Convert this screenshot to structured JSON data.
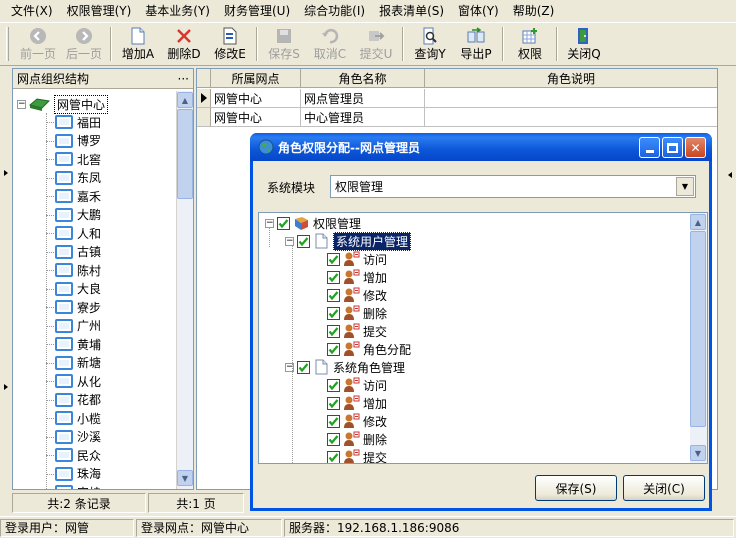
{
  "menu": [
    "文件(X)",
    "权限管理(Y)",
    "基本业务(Y)",
    "财务管理(U)",
    "综合功能(I)",
    "报表清单(S)",
    "窗体(Y)",
    "帮助(Z)"
  ],
  "toolbar": {
    "prev": "前一页",
    "next": "后一页",
    "add": "增加A",
    "delete": "删除D",
    "edit": "修改E",
    "save": "保存S",
    "cancel": "取消C",
    "submit": "提交U",
    "query": "查询Y",
    "export": "导出P",
    "permission": "权限",
    "close": "关闭Q"
  },
  "left_panel": {
    "title": "网点组织结构",
    "menu_dots": "···",
    "root": "网管中心",
    "nodes": [
      "福田",
      "博罗",
      "北窖",
      "东凤",
      "嘉禾",
      "大鹏",
      "人和",
      "古镇",
      "陈村",
      "大良",
      "寮步",
      "广州",
      "黄埔",
      "新塘",
      "从化",
      "花都",
      "小榄",
      "沙溪",
      "民众",
      "珠海",
      "容桂"
    ]
  },
  "grid": {
    "columns": [
      "所属网点",
      "角色名称",
      "角色说明"
    ],
    "rows": [
      {
        "site": "网管中心",
        "role": "网点管理员",
        "desc": ""
      },
      {
        "site": "网管中心",
        "role": "中心管理员",
        "desc": ""
      }
    ]
  },
  "records_bar": {
    "total_records": "共:2 条记录",
    "total_pages": "共:1 页"
  },
  "statusbar": {
    "user": "登录用户：网管",
    "site": "登录网点：网管中心",
    "server": "服务器：192.168.1.186:9086"
  },
  "dialog": {
    "title": "角色权限分配--网点管理员",
    "module_label": "系统模块",
    "module_value": "权限管理",
    "tree": {
      "root": "权限管理",
      "groups": [
        {
          "label": "系统用户管理",
          "items": [
            "访问",
            "增加",
            "修改",
            "删除",
            "提交",
            "角色分配"
          ]
        },
        {
          "label": "系统角色管理",
          "items": [
            "访问",
            "增加",
            "修改",
            "删除",
            "提交"
          ]
        }
      ]
    },
    "save_button": "保存(S)",
    "close_button": "关闭(C)"
  }
}
